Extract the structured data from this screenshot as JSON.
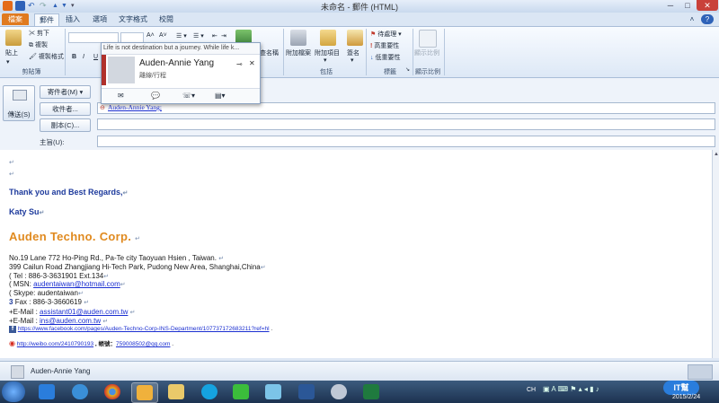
{
  "window": {
    "title": "未命名 - 郵件 (HTML)",
    "help": "?"
  },
  "tabs": [
    "檔案",
    "郵件",
    "插入",
    "選項",
    "文字格式",
    "校閱"
  ],
  "ribbon": {
    "clipboard": {
      "paste": "貼上",
      "cut": "剪下",
      "copy": "複製",
      "format_painter": "複製格式",
      "label": "剪貼簿"
    },
    "font_size_grow": "A˄",
    "font_size_shrink": "A˅",
    "bold": "B",
    "italic": "I",
    "underline": "U",
    "include": {
      "attach_file": "附加檔案",
      "attach_item": "附加項目",
      "signature": "簽名",
      "label": "包括"
    },
    "names_partial": "查名稱",
    "tags": {
      "follow_up": "待處理",
      "high": "高重要性",
      "low": "低重要性",
      "label": "標籤"
    },
    "zoom": {
      "zoom": "顯示比例",
      "label": "顯示比例"
    }
  },
  "tooltip": "Life is not destination but a journey.  While life k...",
  "contact_card": {
    "name": "Auden-Annie Yang",
    "status": "離線/行程"
  },
  "header": {
    "send": "傳送(S)",
    "from": "寄件者(M)",
    "to": "收件者...",
    "cc": "副本(C)...",
    "subject": "主旨(U):",
    "to_value": "Auden-Annie Yang;"
  },
  "body": {
    "thanks": "Thank you and Best Regards,",
    "name": "Katy Su",
    "company": "Auden Techno. Corp.",
    "addr1": "No.19 Lane 772 Ho-Ping Rd., Pa-Te city Taoyuan Hsien , Taiwan.",
    "addr2": "399 Cailun Road Zhangjiang Hi-Tech Park, Pudong New Area, Shanghai,China",
    "tel": "( Tel : 886-3-3631901 Ext.134",
    "msn_prefix": "( MSN: ",
    "msn": "audentaiwan@hotmail.com",
    "skype": "( Skype: audentaiwan",
    "fax": "Fax : 886-3-3660619",
    "email1_prefix": "+E-Mail : ",
    "email1": "assistant01@auden.com.tw",
    "email2_prefix": "+E-Mail : ",
    "email2": "ins@auden.com.tw",
    "facebook": "https://www.facebook.com/pages/Auden-Techno-Corp-INS-Department/107737172683211?ref=hl",
    "weibo": "http://weibo.com/2410790193",
    "weibo_sep": " , 帳號：",
    "qq": "759008502@qq.com"
  },
  "people_pane": {
    "name": "Auden-Annie Yang"
  },
  "taskbar": {
    "language": "CH",
    "date": "2015/2/24",
    "watermark": "IT幫"
  },
  "colors": {
    "file_tab": "#e07a1f",
    "link": "#1b2fd1",
    "company": "#e08a1f",
    "heading": "#1d3a9c"
  }
}
